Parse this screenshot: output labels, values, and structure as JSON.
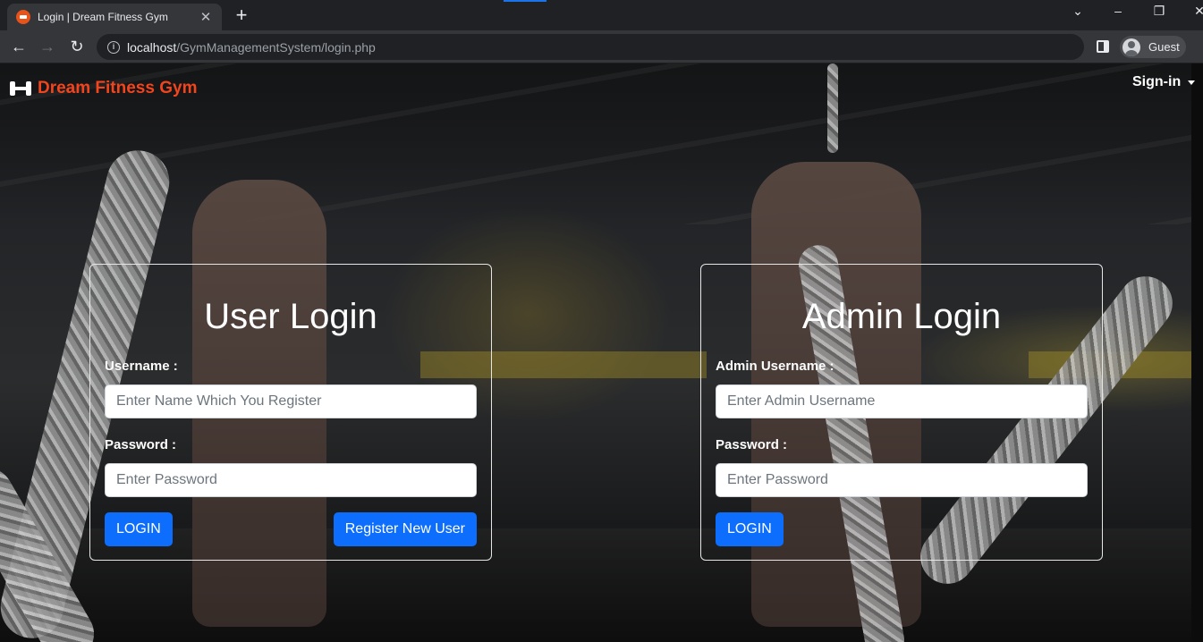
{
  "browser": {
    "tab_title": "Login | Dream Fitness Gym",
    "url_host": "localhost",
    "url_path": "/GymManagementSystem/login.php",
    "profile_name": "Guest"
  },
  "navbar": {
    "brand": "Dream Fitness Gym",
    "signin": "Sign-in",
    "accent_color": "#f2441d"
  },
  "user_login": {
    "title": "User Login",
    "username_label": "Username :",
    "username_placeholder": "Enter Name Which You Register",
    "password_label": "Password :",
    "password_placeholder": "Enter Password",
    "login_button": "LOGIN",
    "register_button": "Register New User"
  },
  "admin_login": {
    "title": "Admin Login",
    "username_label": "Admin Username :",
    "username_placeholder": "Enter Admin Username",
    "password_label": "Password :",
    "password_placeholder": "Enter Password",
    "login_button": "LOGIN"
  },
  "colors": {
    "primary_button": "#0d6efd"
  }
}
